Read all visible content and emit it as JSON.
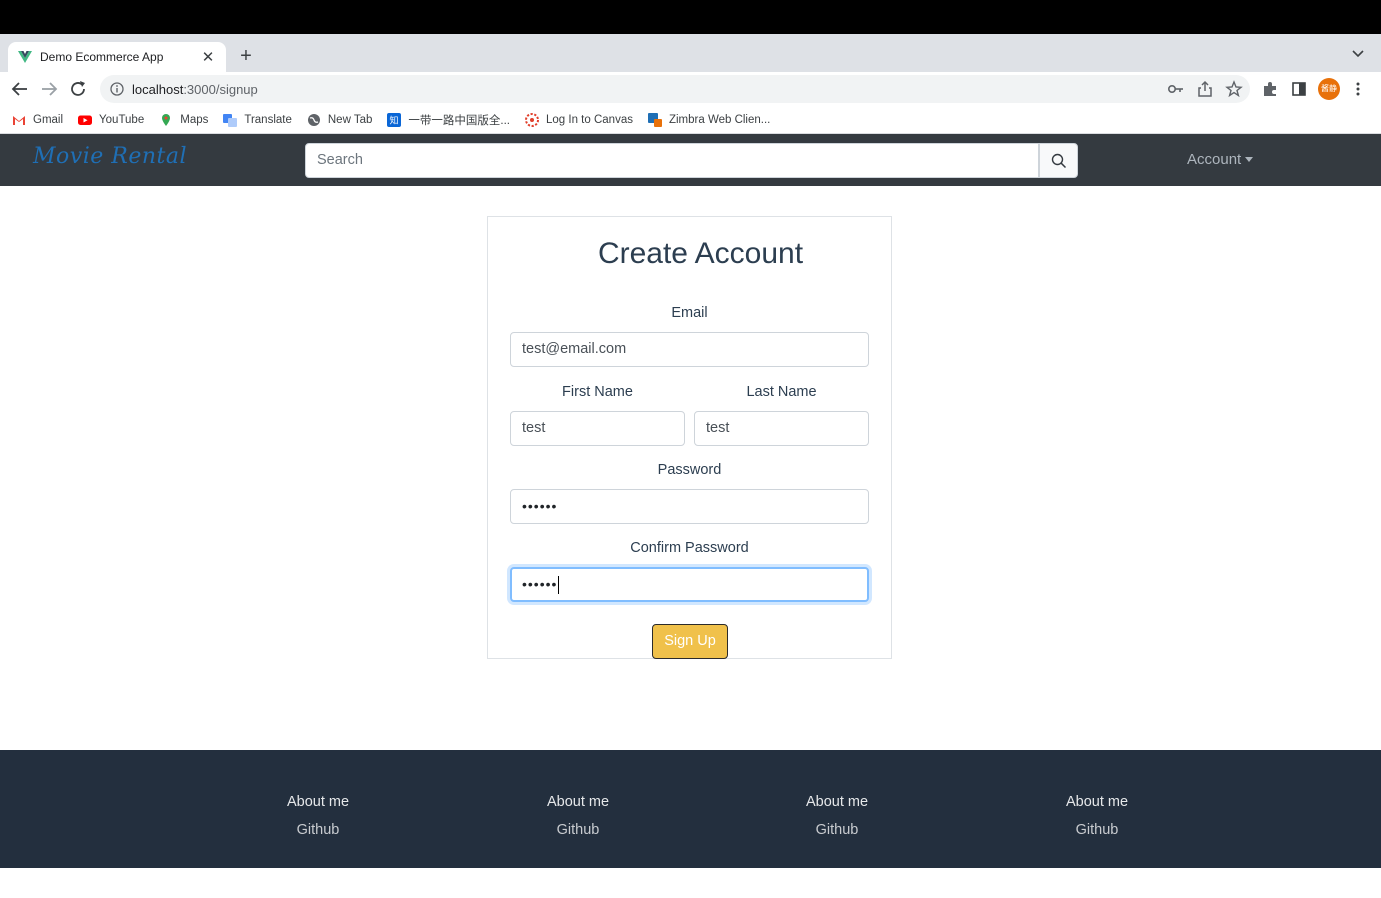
{
  "browser": {
    "tab_title": "Demo Ecommerce App",
    "url_host": "localhost",
    "url_path": ":3000/signup",
    "bookmarks": [
      {
        "label": "Gmail",
        "icon": "gmail-icon"
      },
      {
        "label": "YouTube",
        "icon": "youtube-icon"
      },
      {
        "label": "Maps",
        "icon": "maps-icon"
      },
      {
        "label": "Translate",
        "icon": "translate-icon"
      },
      {
        "label": "New Tab",
        "icon": "globe-icon"
      },
      {
        "label": "一带一路中国版全...",
        "icon": "zhihu-icon"
      },
      {
        "label": "Log In to Canvas",
        "icon": "canvas-icon"
      },
      {
        "label": "Zimbra Web Clien...",
        "icon": "zimbra-icon"
      }
    ],
    "profile_initials": "酱静"
  },
  "navbar": {
    "brand": "Movie Rental",
    "search_placeholder": "Search",
    "account_label": "Account"
  },
  "form": {
    "title": "Create Account",
    "email_label": "Email",
    "email_value": "test@email.com",
    "first_name_label": "First Name",
    "first_name_value": "test",
    "last_name_label": "Last Name",
    "last_name_value": "test",
    "password_label": "Password",
    "password_value": "••••••",
    "confirm_label": "Confirm Password",
    "confirm_value": "••••••",
    "submit_label": "Sign Up"
  },
  "footer": {
    "columns": [
      {
        "about": "About me",
        "github": "Github"
      },
      {
        "about": "About me",
        "github": "Github"
      },
      {
        "about": "About me",
        "github": "Github"
      },
      {
        "about": "About me",
        "github": "Github"
      }
    ]
  },
  "colors": {
    "navbar_bg": "#343a40",
    "footer_bg": "#232f3e",
    "button_bg": "#f0c14b",
    "brand": "#1f6fb5"
  }
}
